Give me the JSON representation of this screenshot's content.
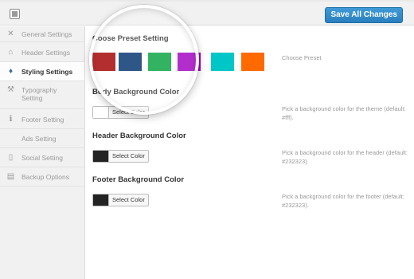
{
  "toolbar": {
    "menu_icon": "menu-icon",
    "save_label": "Save All Changes"
  },
  "sidebar": {
    "items": [
      {
        "label": "General Settings",
        "icon": "tools-icon",
        "glyph": "✕"
      },
      {
        "label": "Header Settings",
        "icon": "home-icon",
        "glyph": "⌂"
      },
      {
        "label": "Styling Settings",
        "icon": "paint-icon",
        "glyph": "♦"
      },
      {
        "label": "Typography Setting",
        "icon": "wrench-icon",
        "glyph": "⚒"
      },
      {
        "label": "Footer Setting",
        "icon": "info-icon",
        "glyph": "ℹ"
      },
      {
        "label": "Ads Setting",
        "icon": "",
        "glyph": ""
      },
      {
        "label": "Social Setting",
        "icon": "document-icon",
        "glyph": "▯"
      },
      {
        "label": "Backup Options",
        "icon": "database-icon",
        "glyph": "▤"
      }
    ]
  },
  "preset": {
    "title": "Coose Preset Setting",
    "description": "Choose Preset",
    "colors": [
      "#a30000",
      "#00336e",
      "#06a33f",
      "#a100c1",
      "#00c7c7",
      "#ff6a00"
    ]
  },
  "body_bg": {
    "title": "Body Background Color",
    "button": "Select Color",
    "swatch_color": "#ffffff",
    "description": "Pick a background color for the theme (default: #fff)."
  },
  "header_bg": {
    "title": "Header Background Color",
    "button": "Select Color",
    "swatch_color": "#232323",
    "description": "Pick a background color for the header (default: #232323)."
  },
  "footer_bg": {
    "title": "Footer Background Color",
    "button": "Select Color",
    "swatch_color": "#232323",
    "description": "Pick a background color for the footer (default: #232323)."
  }
}
